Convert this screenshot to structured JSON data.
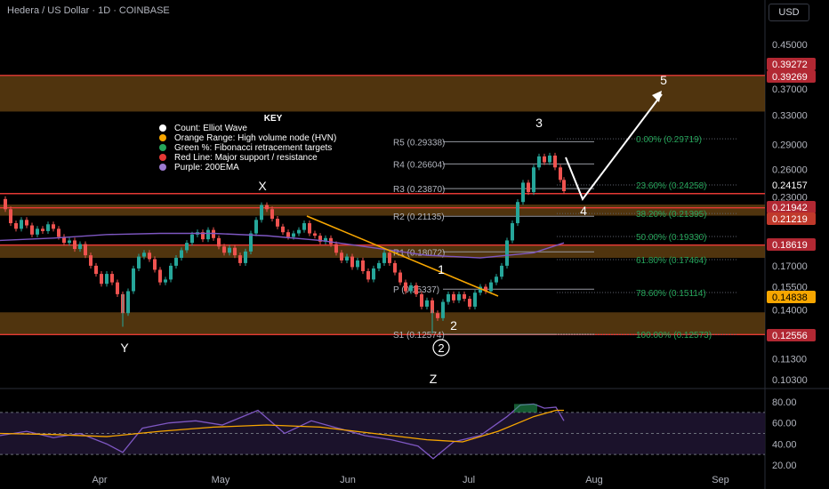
{
  "header": {
    "title": "Hedera / US Dollar · 1D · COINBASE",
    "currency": "USD"
  },
  "chart_data": {
    "type": "candlestick",
    "price_axis": {
      "ticks": [
        "0.45000",
        "0.37000",
        "0.33000",
        "0.29000",
        "0.26000",
        "0.23000",
        "0.17000",
        "0.15500",
        "0.14000",
        "0.11300",
        "0.10300"
      ],
      "ylim": [
        0.098,
        0.52
      ],
      "scale": "log"
    },
    "price_badges": [
      {
        "label": "0.39272",
        "color": "#b22833"
      },
      {
        "label": "0.39269",
        "color": "#b22833"
      },
      {
        "label": "0.24157",
        "color": "#000000"
      },
      {
        "label": "0.21942",
        "color": "#b22833"
      },
      {
        "label": "0.21219",
        "color": "#c0392b"
      },
      {
        "label": "0.18619",
        "color": "#b22833"
      },
      {
        "label": "0.14838",
        "color": "#f7a600"
      },
      {
        "label": "0.12556",
        "color": "#b22833"
      }
    ],
    "x_axis": {
      "months": [
        "Apr",
        "May",
        "Jun",
        "Jul",
        "Aug",
        "Sep"
      ]
    },
    "key": {
      "title": "KEY",
      "items": [
        {
          "label": "Count: Elliot Wave",
          "color": "#ffffff"
        },
        {
          "label": "Orange Range: High volume node (HVN)",
          "color": "#f7a600"
        },
        {
          "label": "Green %: Fibonacci retracement targets",
          "color": "#26a65b"
        },
        {
          "label": "Red Line: Major support / resistance",
          "color": "#e53935"
        },
        {
          "label": "Purple: 200EMA",
          "color": "#9c7bd1"
        }
      ]
    },
    "hvn_zones": [
      [
        0.335,
        0.392
      ],
      [
        0.2119,
        0.2225
      ],
      [
        0.176,
        0.1862
      ],
      [
        0.1256,
        0.1385
      ]
    ],
    "red_lines": [
      0.39272,
      0.21942,
      0.18619,
      0.12556
    ],
    "pivots": [
      {
        "label": "R5 (0.29338)",
        "value": 0.29338
      },
      {
        "label": "R4 (0.26604)",
        "value": 0.26604
      },
      {
        "label": "R3 (0.23870)",
        "value": 0.2387
      },
      {
        "label": "R2 (0.21135)",
        "value": 0.21135
      },
      {
        "label": "R1 (0.18072)",
        "value": 0.18072
      },
      {
        "label": "P (0.15337)",
        "value": 0.15337
      },
      {
        "label": "S1 (0.12574)",
        "value": 0.12574
      }
    ],
    "fibs": [
      {
        "label": "0.00% (0.29719)",
        "value": 0.29719
      },
      {
        "label": "23.60% (0.24258)",
        "value": 0.24258
      },
      {
        "label": "38.20% (0.21395)",
        "value": 0.21395
      },
      {
        "label": "50.00% (0.19330)",
        "value": 0.1933
      },
      {
        "label": "61.80% (0.17464)",
        "value": 0.17464
      },
      {
        "label": "78.60% (0.15114)",
        "value": 0.15114
      },
      {
        "label": "100.00% (0.12573)",
        "value": 0.12573
      }
    ],
    "wave_labels": [
      "X",
      "Y",
      "Z",
      "1",
      "2",
      "3",
      "4",
      "5",
      "2"
    ],
    "rsi": {
      "ticks": [
        "80.00",
        "60.00",
        "40.00",
        "20.00"
      ],
      "levels": [
        70,
        30
      ]
    }
  },
  "colors": {
    "up": "#26a69a",
    "down": "#ef5350",
    "hvn": "#6b4513",
    "red": "#e53935",
    "fib": "#26a65b",
    "ema": "#7e57c2",
    "rsi": "#7e57c2",
    "rsi_ma": "#f7a600"
  }
}
